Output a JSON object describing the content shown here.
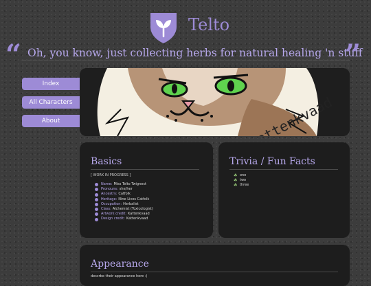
{
  "colors": {
    "accent": "#9d8bd6",
    "panel": "#1d1d1d",
    "background": "#3c3c3c"
  },
  "header": {
    "logo_icon": "sprout-shield-icon",
    "title": "Telto",
    "open_quote": "“",
    "close_quote": "”",
    "tagline": "Oh, you know, just collecting herbs for natural healing 'n stuff"
  },
  "nav": [
    {
      "label": "Index"
    },
    {
      "label": "All Characters"
    },
    {
      "label": "About"
    }
  ],
  "banner": {
    "artist_signature": "kattenkvaad"
  },
  "basics": {
    "title": "Basics",
    "status": "[ WORK IN PROGRESS ]",
    "facts": [
      {
        "key": "Name:",
        "value": "Miss Telto Twignest"
      },
      {
        "key": "Pronouns:",
        "value": "she/her"
      },
      {
        "key": "Ancestry:",
        "value": "Catfolk"
      },
      {
        "key": "Heritage:",
        "value": "Nine Lives Catfolk"
      },
      {
        "key": "Occupation:",
        "value": "Herbalist"
      },
      {
        "key": "Class:",
        "value": "Alchemist (Toxicologist)"
      },
      {
        "key": "Artwork credit:",
        "value": "Kattenkvaad"
      },
      {
        "key": "Design credit:",
        "value": "Kattenkvaad"
      }
    ]
  },
  "trivia": {
    "title": "Trivia / Fun Facts",
    "bullet_icon": "sprout-icon",
    "items": [
      "one",
      "two",
      "three"
    ]
  },
  "appearance": {
    "title": "Appearance",
    "text": "descrbe their appearance here :)"
  }
}
